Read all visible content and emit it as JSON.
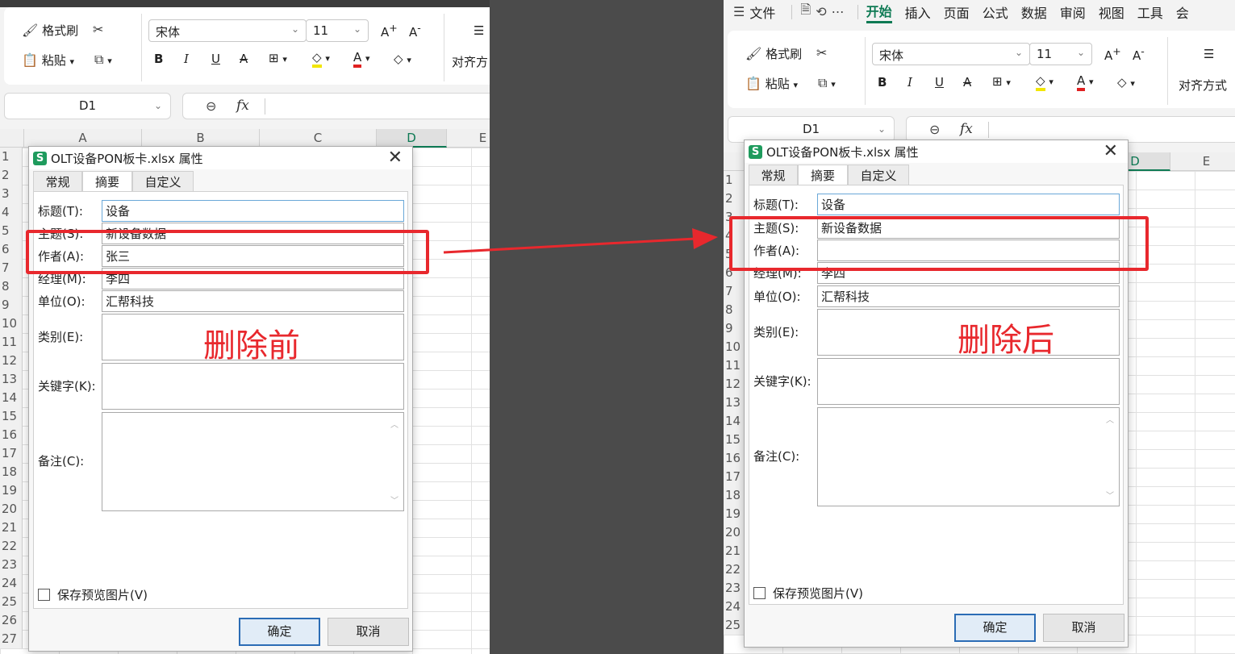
{
  "left": {
    "ribbon": {
      "format_painter": "格式刷",
      "paste": "粘贴",
      "font_name": "宋体",
      "font_size": "11",
      "align_label": "对齐方"
    },
    "name_box": "D1",
    "columns": [
      "A",
      "B",
      "C",
      "D",
      "E"
    ],
    "rows": [
      "1",
      "2",
      "3",
      "4",
      "5",
      "6",
      "7",
      "8",
      "9",
      "10",
      "11",
      "12",
      "13",
      "14",
      "15",
      "16",
      "17",
      "18",
      "19",
      "20",
      "21",
      "22",
      "23",
      "24",
      "25",
      "26",
      "27"
    ],
    "dialog": {
      "title": "OLT设备PON板卡.xlsx 属性",
      "app_icon": "S",
      "tabs": [
        "常规",
        "摘要",
        "自定义"
      ],
      "fields": {
        "title_label": "标题(T):",
        "title_value": "设备",
        "subject_label": "主题(S):",
        "subject_value": "新设备数据",
        "author_label": "作者(A):",
        "author_value": "张三",
        "manager_label": "经理(M):",
        "manager_value": "李四",
        "company_label": "单位(O):",
        "company_value": "汇帮科技",
        "category_label": "类别(E):",
        "category_value": "",
        "keywords_label": "关键字(K):",
        "keywords_value": "",
        "comments_label": "备注(C):",
        "comments_value": ""
      },
      "save_preview": "保存预览图片(V)",
      "ok": "确定",
      "cancel": "取消"
    },
    "annotation": "删除前"
  },
  "right": {
    "menu": {
      "menu_icon": "☰",
      "file": "文件",
      "tabs": [
        "开始",
        "插入",
        "页面",
        "公式",
        "数据",
        "审阅",
        "视图",
        "工具",
        "会"
      ]
    },
    "ribbon": {
      "format_painter": "格式刷",
      "paste": "粘贴",
      "font_name": "宋体",
      "font_size": "11",
      "align_label": "对齐方式"
    },
    "name_box": "D1",
    "columns": [
      "D",
      "E"
    ],
    "rows": [
      "1",
      "2",
      "3",
      "4",
      "5",
      "6",
      "7",
      "8",
      "9",
      "10",
      "11",
      "12",
      "13",
      "14",
      "15",
      "16",
      "17",
      "18",
      "19",
      "20",
      "21",
      "22",
      "23",
      "24",
      "25"
    ],
    "dialog": {
      "title": "OLT设备PON板卡.xlsx 属性",
      "app_icon": "S",
      "tabs": [
        "常规",
        "摘要",
        "自定义"
      ],
      "fields": {
        "title_label": "标题(T):",
        "title_value": "设备",
        "subject_label": "主题(S):",
        "subject_value": "新设备数据",
        "author_label": "作者(A):",
        "author_value": "",
        "manager_label": "经理(M):",
        "manager_value": "李四",
        "company_label": "单位(O):",
        "company_value": "汇帮科技",
        "category_label": "类别(E):",
        "category_value": "",
        "keywords_label": "关键字(K):",
        "keywords_value": "",
        "comments_label": "备注(C):",
        "comments_value": ""
      },
      "save_preview": "保存预览图片(V)",
      "ok": "确定",
      "cancel": "取消"
    },
    "annotation": "删除后"
  },
  "colors": {
    "annotation_red": "#e8282d",
    "accent_green": "#0e7a54",
    "ok_border": "#2b6cb5"
  },
  "icons": [
    "format-painter-icon",
    "scissors-icon",
    "paste-icon",
    "copy-icon",
    "bold-icon",
    "italic-icon",
    "underline-icon",
    "strikethrough-icon",
    "border-icon",
    "fill-color-icon",
    "font-color-icon",
    "eraser-icon",
    "zoom-icon",
    "fx-icon",
    "close-icon",
    "checkbox-icon",
    "arrow-icon",
    "save-icon",
    "undo-icon",
    "more-icon",
    "menu-icon"
  ]
}
